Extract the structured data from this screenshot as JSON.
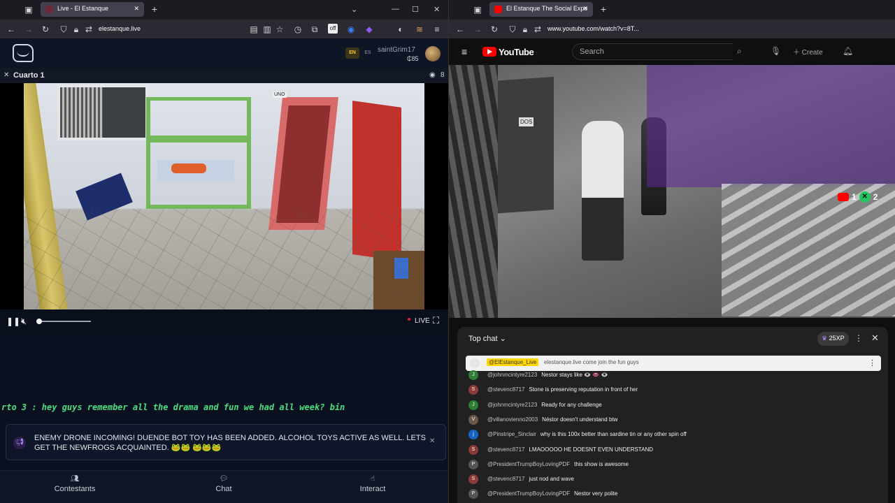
{
  "left_browser": {
    "tab_title": "Live - El Estanque",
    "url": "elestanque.live"
  },
  "site": {
    "lang_en": "EN",
    "lang_es": "ES",
    "username": "saintGrim17",
    "coins": "₵85",
    "room_title": "Cuarto 1",
    "viewer_count": "8",
    "live_label": "LIVE",
    "ticker_text": "rto 3 : hey guys remember all the drama and fun we had all week? bin",
    "notice": "ENEMY DRONE INCOMING! DUENDE BOT TOY HAS BEEN ADDED. ALCOHOL TOYS ACTIVE AS WELL. LETS GET THE NEWFROGS ACQUAINTED. 🐸🐸 🐸🐸🐸",
    "nav": [
      "Contestants",
      "Chat",
      "Interact"
    ],
    "volume_percent": 0,
    "scene_labels": {
      "door_sign": "UNO"
    }
  },
  "right_browser": {
    "tab_title": "El Estanque The Social Expe",
    "url": "www.youtube.com/watch?v=8T...",
    "brand": "YouTube",
    "search_placeholder": "Search",
    "create_label": "Create",
    "overlay_yt_count": "1",
    "overlay_x_count": "2",
    "scene_labels": {
      "door_sign": "DOS"
    }
  },
  "chat": {
    "mode": "Top chat",
    "xp": "25XP",
    "pinned": {
      "author": "@ElEstanque_Live",
      "text": "elestanque.live come join the fun guys"
    },
    "messages": [
      {
        "author": "@johnmcintyre2123",
        "text": "Nestor stays like 👁️ 👄 👁️",
        "avatar": "J",
        "color": "#2e7d32"
      },
      {
        "author": "@stevenc8717",
        "text": "Stone is preserving reputation in front of her",
        "avatar": "S",
        "color": "#8b3a3a"
      },
      {
        "author": "@johnmcintyre2123",
        "text": "Ready for any challenge",
        "avatar": "J",
        "color": "#2e7d32"
      },
      {
        "author": "@villanovienno2003",
        "text": "Néstor doesn't understand btw",
        "avatar": "V",
        "color": "#6b5a4a"
      },
      {
        "author": "@Pinstripe_Sinclair",
        "text": "why is this 100x better than sardine tin or any other spin off",
        "avatar": "j",
        "color": "#1565c0"
      },
      {
        "author": "@stevenc8717",
        "text": "LMAOOOOO HE DOESNT EVEN UNDERSTAND",
        "avatar": "S",
        "color": "#8b3a3a"
      },
      {
        "author": "@PresidentTrumpBoyLovingPDF",
        "text": "this show is awesome",
        "avatar": "P",
        "color": "#555555"
      },
      {
        "author": "@stevenc8717",
        "text": "just nod and wave",
        "avatar": "S",
        "color": "#8b3a3a"
      },
      {
        "author": "@PresidentTrumpBoyLovingPDF",
        "text": "Nestor very polite",
        "avatar": "P",
        "color": "#555555"
      }
    ]
  },
  "colors": {
    "accent_green": "#4ade80",
    "yt_red": "#ff0000",
    "live_red": "#e11d48"
  }
}
